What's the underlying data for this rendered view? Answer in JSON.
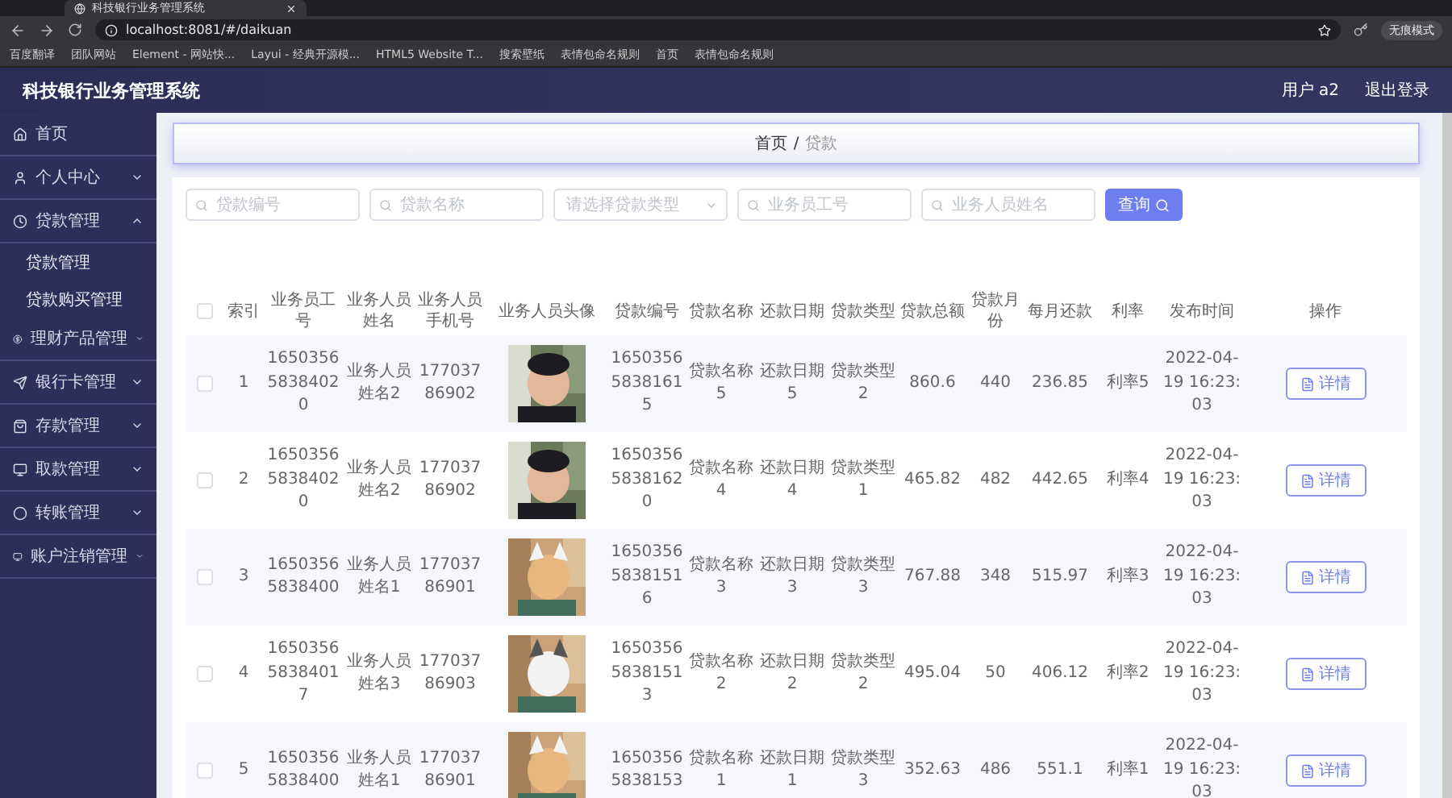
{
  "browser": {
    "tab_title": "科技银行业务管理系统",
    "url": "localhost:8081/#/daikuan",
    "profile": "无痕模式",
    "bookmarks": [
      "百度翻译",
      "团队网站",
      "Element - 网站快...",
      "Layui - 经典开源模...",
      "HTML5 Website T...",
      "搜索壁纸",
      "表情包命名规则",
      "首页",
      "表情包命名规则"
    ]
  },
  "header": {
    "title": "科技银行业务管理系统",
    "user": "用户 a2",
    "logout": "退出登录"
  },
  "sidebar": {
    "items": [
      {
        "label": "首页",
        "kind": "link"
      },
      {
        "label": "个人中心",
        "kind": "group",
        "expanded": false
      },
      {
        "label": "贷款管理",
        "kind": "group",
        "expanded": true,
        "children": [
          {
            "label": "贷款管理"
          },
          {
            "label": "贷款购买管理"
          }
        ]
      },
      {
        "label": "理财产品管理",
        "kind": "group",
        "expanded": false
      },
      {
        "label": "银行卡管理",
        "kind": "group",
        "expanded": false
      },
      {
        "label": "存款管理",
        "kind": "group",
        "expanded": false
      },
      {
        "label": "取款管理",
        "kind": "group",
        "expanded": false
      },
      {
        "label": "转账管理",
        "kind": "group",
        "expanded": false
      },
      {
        "label": "账户注销管理",
        "kind": "group",
        "expanded": false
      }
    ]
  },
  "breadcrumb": {
    "separator": "/",
    "items": [
      "首页",
      "贷款"
    ]
  },
  "filters": [
    {
      "kind": "text",
      "placeholder": "贷款编号"
    },
    {
      "kind": "text",
      "placeholder": "贷款名称"
    },
    {
      "kind": "select",
      "placeholder": "请选择贷款类型"
    },
    {
      "kind": "text",
      "placeholder": "业务员工号"
    },
    {
      "kind": "text",
      "placeholder": "业务人员姓名"
    }
  ],
  "search_button": "查询",
  "table": {
    "header_checked": false,
    "columns": [
      "索引",
      "业务员工号",
      "业务人员姓名",
      "业务人员手机号",
      "业务人员头像",
      "贷款编号",
      "贷款名称",
      "还款日期",
      "贷款类型",
      "贷款总额",
      "贷款月份",
      "每月还款",
      "利率",
      "发布时间",
      "操作"
    ],
    "rows": [
      {
        "checked": false,
        "cells": [
          "1",
          "165035658384020",
          "业务人员姓名2",
          "17703786902",
          "",
          "165035658381615",
          "贷款名称5",
          "还款日期5",
          "贷款类型2",
          "860.6",
          "440",
          "236.85",
          "利率5",
          "2022-04-19 16:23:03",
          "详情"
        ]
      },
      {
        "checked": false,
        "cells": [
          "2",
          "165035658384020",
          "业务人员姓名2",
          "17703786902",
          "",
          "165035658381620",
          "贷款名称4",
          "还款日期4",
          "贷款类型1",
          "465.82",
          "482",
          "442.65",
          "利率4",
          "2022-04-19 16:23:03",
          "详情"
        ]
      },
      {
        "checked": false,
        "cells": [
          "3",
          "16503565838400",
          "业务人员姓名1",
          "17703786901",
          "",
          "165035658381516",
          "贷款名称3",
          "还款日期3",
          "贷款类型3",
          "767.88",
          "348",
          "515.97",
          "利率3",
          "2022-04-19 16:23:03",
          "详情"
        ]
      },
      {
        "checked": false,
        "cells": [
          "4",
          "165035658384017",
          "业务人员姓名3",
          "17703786903",
          "",
          "165035658381513",
          "贷款名称2",
          "还款日期2",
          "贷款类型2",
          "495.04",
          "50",
          "406.12",
          "利率2",
          "2022-04-19 16:23:03",
          "详情"
        ]
      },
      {
        "checked": false,
        "cells": [
          "5",
          "16503565838400",
          "业务人员姓名1",
          "17703786901",
          "",
          "16503565838153",
          "贷款名称1",
          "还款日期1",
          "贷款类型3",
          "352.63",
          "486",
          "551.1",
          "利率1",
          "2022-04-19 16:23:03",
          "详情"
        ]
      }
    ]
  }
}
